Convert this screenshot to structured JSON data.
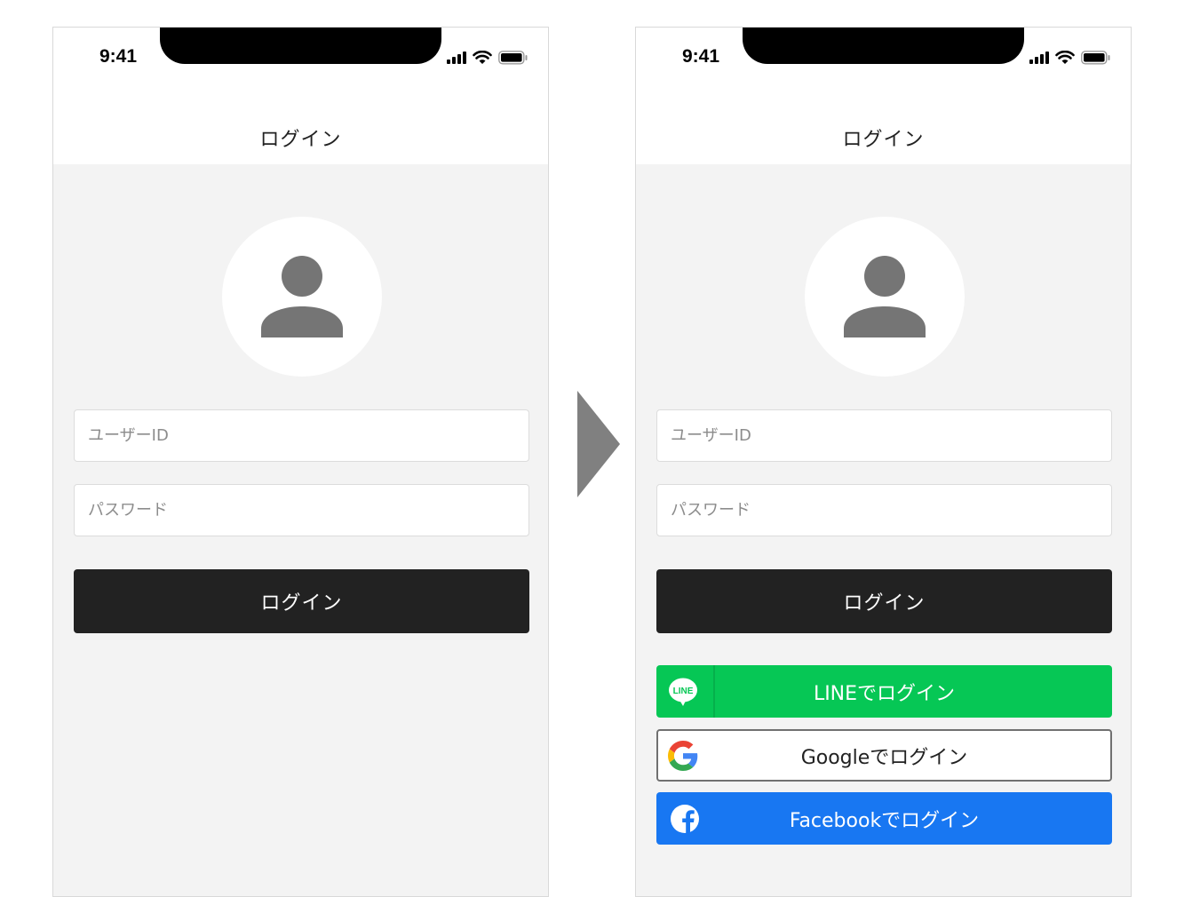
{
  "status_bar": {
    "time": "9:41"
  },
  "screen_before": {
    "header_title": "ログイン",
    "user_id_placeholder": "ユーザーID",
    "password_placeholder": "パスワード",
    "login_button": "ログイン"
  },
  "screen_after": {
    "header_title": "ログイン",
    "user_id_placeholder": "ユーザーID",
    "password_placeholder": "パスワード",
    "login_button": "ログイン",
    "line_icon_text": "LINE",
    "line_button": "LINEでログイン",
    "google_button": "Googleでログイン",
    "facebook_button": "Facebookでログイン"
  },
  "icons": {
    "avatar": "user-silhouette-icon",
    "arrow": "arrow-right-icon",
    "line": "line-logo-icon",
    "google": "google-logo-icon",
    "facebook": "facebook-logo-icon"
  },
  "colors": {
    "login_button": "#222222",
    "line_green": "#06c755",
    "facebook_blue": "#1877f2",
    "background_gray": "#f3f3f3",
    "arrow_gray": "#808080"
  }
}
